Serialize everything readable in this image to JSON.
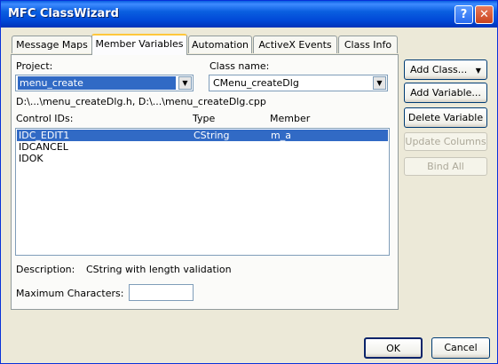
{
  "window": {
    "title": "MFC ClassWizard",
    "help_label": "?",
    "close_label": "✕"
  },
  "tabs": [
    {
      "label": "Message Maps"
    },
    {
      "label": "Member Variables"
    },
    {
      "label": "Automation"
    },
    {
      "label": "ActiveX Events"
    },
    {
      "label": "Class Info"
    }
  ],
  "project": {
    "label": "Project:",
    "value": "menu_create"
  },
  "class_name": {
    "label": "Class name:",
    "value": "CMenu_createDlg"
  },
  "file_path": "D:\\...\\menu_createDlg.h, D:\\...\\menu_createDlg.cpp",
  "list": {
    "headers": {
      "control_ids": "Control IDs:",
      "type": "Type",
      "member": "Member"
    },
    "rows": [
      {
        "id": "IDC_EDIT1",
        "type": "CString",
        "member": "m_a"
      },
      {
        "id": "IDCANCEL",
        "type": "",
        "member": ""
      },
      {
        "id": "IDOK",
        "type": "",
        "member": ""
      }
    ]
  },
  "description": {
    "label": "Description:",
    "value": "CString with length validation"
  },
  "max_chars": {
    "label": "Maximum Characters:",
    "value": ""
  },
  "buttons": {
    "add_class": "Add Class...",
    "add_class_arrow": "▼",
    "add_variable": "Add Variable...",
    "delete_variable": "Delete Variable",
    "update_columns": "Update Columns",
    "bind_all": "Bind All",
    "ok": "OK",
    "cancel": "Cancel"
  },
  "colors": {
    "title_bar": "#0A5FE0",
    "selection": "#316AC5",
    "dialog_bg": "#ECE9D8"
  }
}
